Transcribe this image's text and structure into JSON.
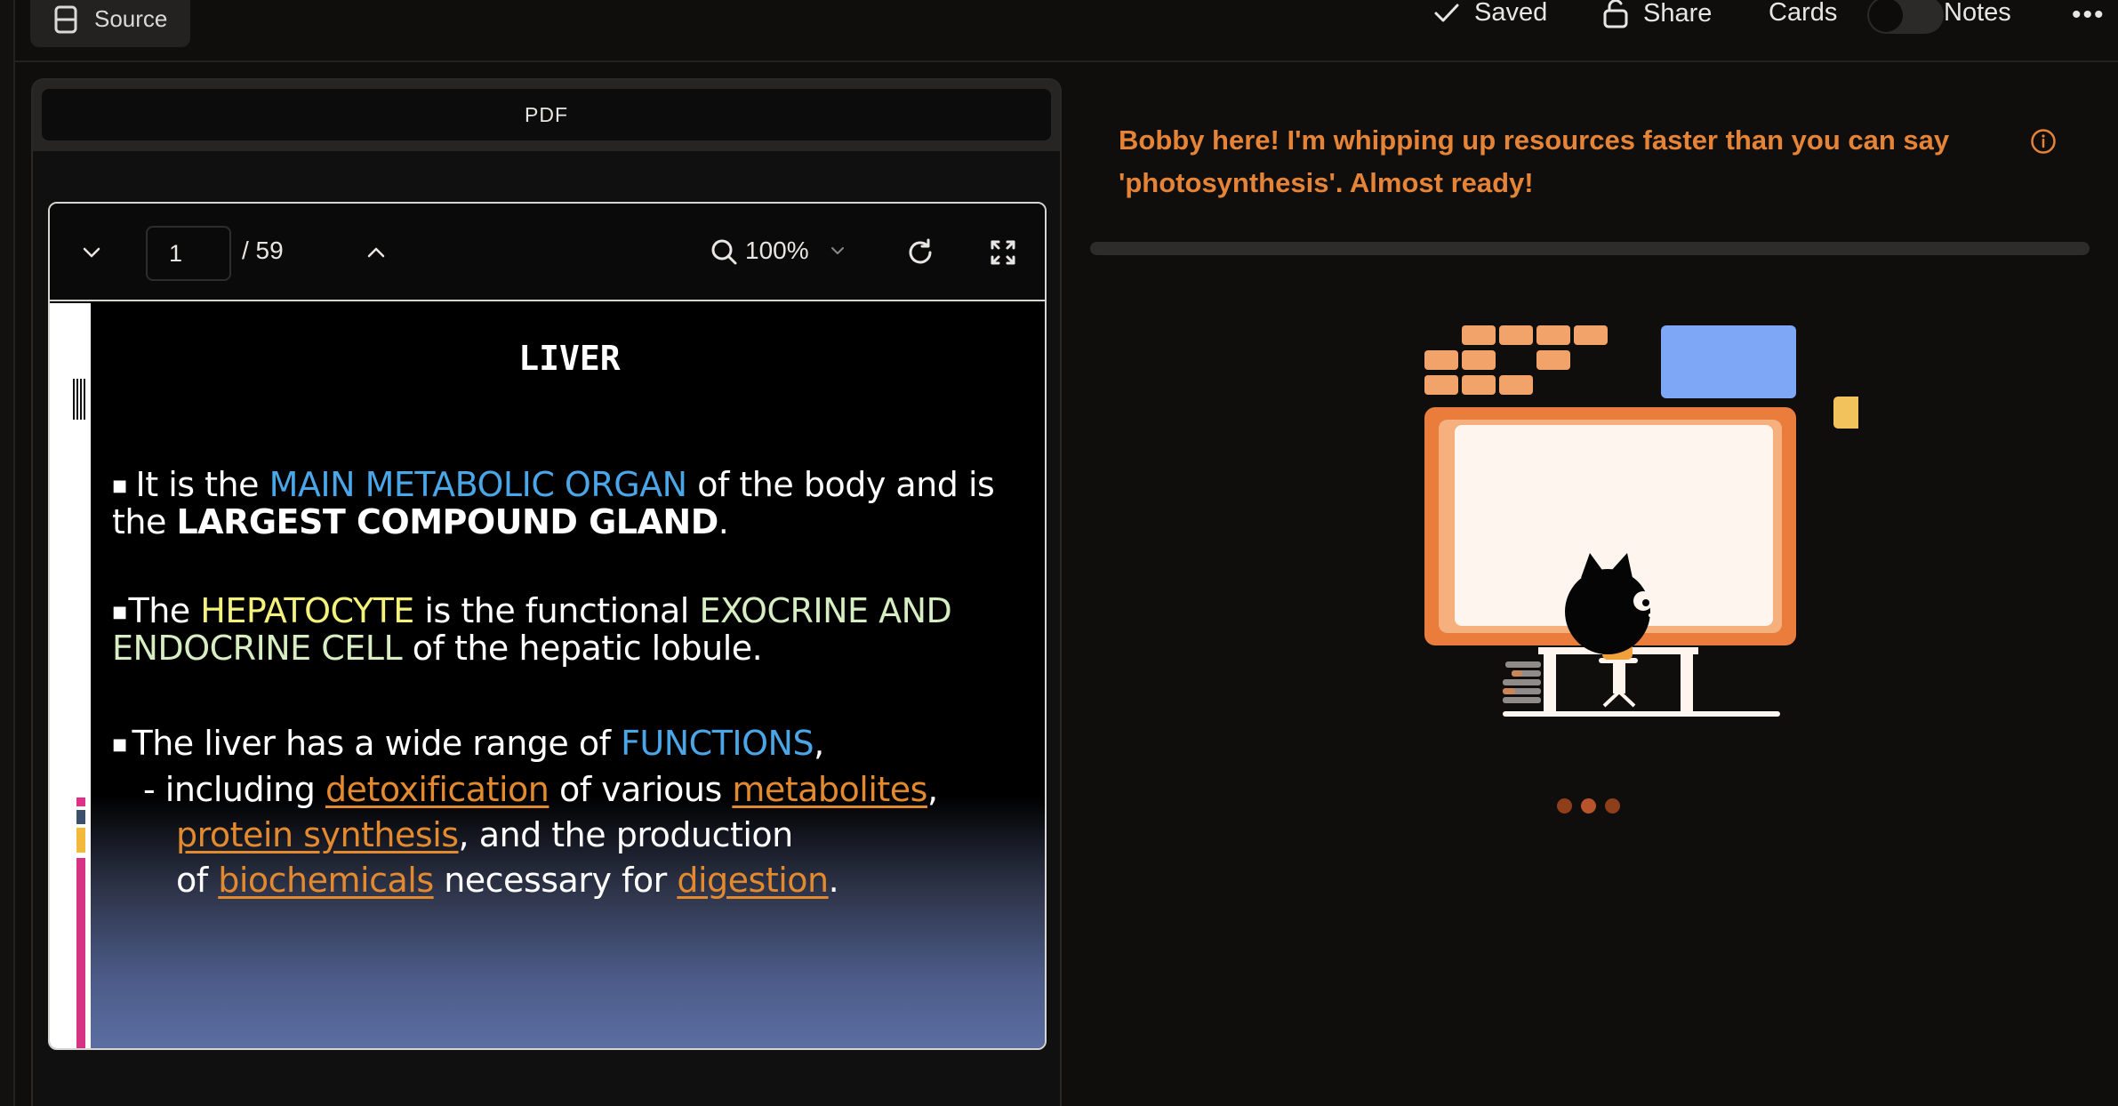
{
  "topbar": {
    "source_label": "Source",
    "saved_label": "Saved",
    "share_label": "Share",
    "cards_label": "Cards",
    "cards_toggle_on": false,
    "notes_label": "Notes",
    "more_label": "•••"
  },
  "pdf_panel": {
    "tab_label": "PDF",
    "toolbar": {
      "current_page": "1",
      "total_pages": "/ 59",
      "zoom": "100%"
    },
    "slide": {
      "title": "LIVER",
      "bullet1": {
        "t1": "It is the ",
        "h1": "MAIN METABOLIC ORGAN",
        "t2": " of the body and is",
        "t3": "the ",
        "h2": "LARGEST COMPOUND GLAND",
        "t4": "."
      },
      "bullet2": {
        "t1": "The ",
        "h1": "HEPATOCYTE",
        "t2": " is the functional ",
        "h2": "EXOCRINE AND",
        "h3": "ENDOCRINE CELL",
        "t3": " of the hepatic lobule."
      },
      "bullet3": {
        "t1": "The liver has a wide range of ",
        "h1": "FUNCTIONS",
        "t2": ",",
        "t3": "- including ",
        "l1": "detoxification",
        "t4": " of various ",
        "l2": "metabolites",
        "t5": ",",
        "l3": "protein  synthesis",
        "t6": ", and  the production",
        "t7": "of ",
        "l4": "biochemicals",
        "t8": " necessary for ",
        "l5": "digestion",
        "t9": "."
      }
    }
  },
  "assistant": {
    "message_line1": "Bobby here! I'm whipping up resources faster than you can say",
    "message_line2": "'photosynthesis'. Almost ready!"
  },
  "colors": {
    "accent_orange": "#e58336",
    "link_orange": "#e48a2e",
    "highlight_blue": "#4aa6e6",
    "highlight_yellow": "#f4f27a",
    "illustration_blue": "#7ea7f5",
    "illustration_yellow": "#f2c35c"
  }
}
